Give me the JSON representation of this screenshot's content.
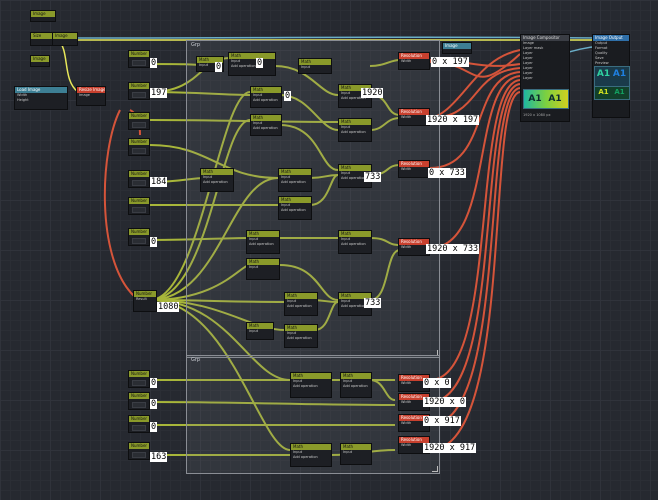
{
  "canvas": {
    "background": "#262930",
    "wire_green": "#a8b63a",
    "wire_red": "#d5543a",
    "wire_yellow": "#e8e85a",
    "wire_blue": "#6aaec8"
  },
  "groups": [
    {
      "title": "Grp"
    },
    {
      "title": "Grp"
    }
  ],
  "value_labels": [
    "0",
    "0",
    "0",
    "197",
    "0",
    "1920",
    "184",
    "0",
    "1080",
    "733",
    "733",
    "0",
    "0",
    "0",
    "163",
    "0 x 197",
    "1920 x 197",
    "0 x 733",
    "1920 x 733",
    "0 x 0",
    "1920 x 0",
    "0 x 917",
    "1920 x 917"
  ],
  "nodes": {
    "input_nodes": [
      {
        "title": "Number",
        "row": "0"
      },
      {
        "title": "Number",
        "row": "197"
      },
      {
        "title": "Number",
        "row": "0"
      },
      {
        "title": "Number",
        "row": "0"
      },
      {
        "title": "Number",
        "row": "184"
      },
      {
        "title": "Number",
        "row": "0"
      },
      {
        "title": "Number",
        "row": "0"
      },
      {
        "title": "Number",
        "row": "0"
      },
      {
        "title": "Number",
        "row": "0"
      },
      {
        "title": "Number",
        "row": "0"
      },
      {
        "title": "Number",
        "row": "163"
      }
    ],
    "math_title": "Math",
    "math_rows": [
      "Input",
      "Input",
      "Result",
      "Add operation"
    ],
    "resolution_title": "Resolution",
    "resolution_rows": [
      "Width",
      "Height",
      "Resolution"
    ],
    "resize_title": "Resize Image",
    "compositor_title": "Image Compositor",
    "compositor_rows": [
      "Image",
      "Layer mask",
      "Layer",
      "Layer",
      "Layer",
      "Layer",
      "Layer",
      "Layer",
      "Layer"
    ],
    "output_title": "Image Output",
    "output_rows": [
      "Output",
      "Format",
      "Quality",
      "Save",
      "Preview"
    ],
    "top_small": [
      "Image",
      "Size",
      "Image"
    ],
    "loader_title": "Load Image",
    "loader_rows": [
      "Width",
      "Height",
      "Image",
      "Alpha"
    ]
  },
  "preview": {
    "tiles": [
      "A1",
      "A1",
      "A1",
      "A1"
    ],
    "tile_colors": [
      "#2fd0a0",
      "#1f7fe0",
      "#d0e020",
      "#13a060"
    ],
    "caption": "1920 x 1080 px"
  }
}
